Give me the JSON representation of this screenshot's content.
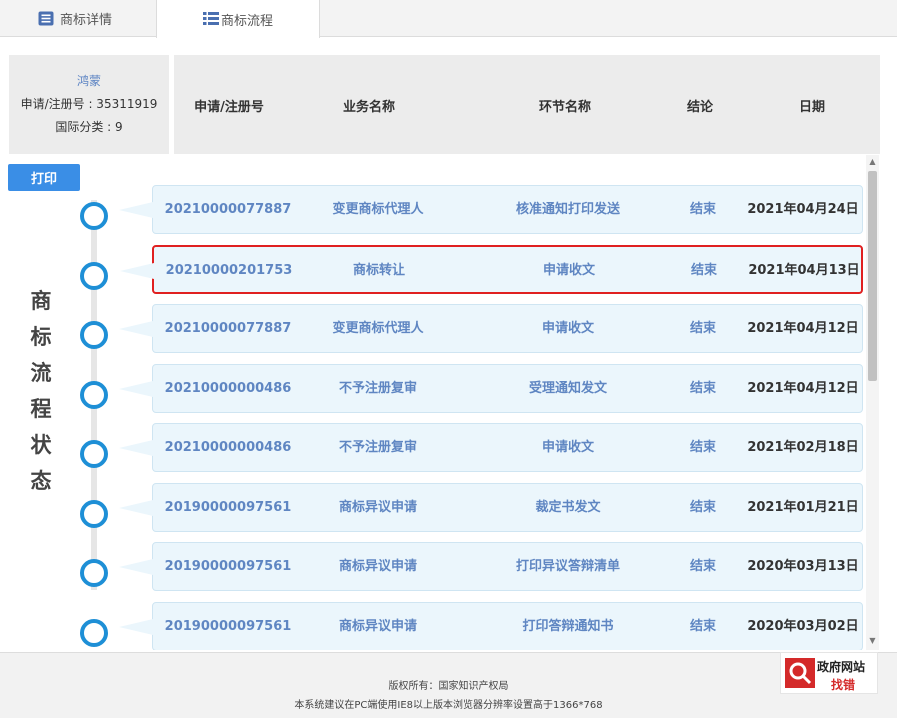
{
  "tabs": [
    {
      "label": "商标详情",
      "icon": "document-list-icon"
    },
    {
      "label": "商标流程",
      "icon": "grid-list-icon"
    }
  ],
  "info": {
    "name": "鸿蒙",
    "reg_line": "申请/注册号 : 35311919",
    "class_line": "国际分类 : 9"
  },
  "header": {
    "reg_no": "申请/注册号",
    "business": "业务名称",
    "step": "环节名称",
    "result": "结论",
    "date": "日期"
  },
  "print_label": "打印",
  "side_title": [
    "商",
    "标",
    "流",
    "程",
    "状",
    "态"
  ],
  "rows": [
    {
      "reg_no": "20210000077887",
      "business": "变更商标代理人",
      "step": "核准通知打印发送",
      "result": "结束",
      "date": "2021年04月24日"
    },
    {
      "reg_no": "20210000201753",
      "business": "商标转让",
      "step": "申请收文",
      "result": "结束",
      "date": "2021年04月13日",
      "highlighted": true
    },
    {
      "reg_no": "20210000077887",
      "business": "变更商标代理人",
      "step": "申请收文",
      "result": "结束",
      "date": "2021年04月12日"
    },
    {
      "reg_no": "20210000000486",
      "business": "不予注册复审",
      "step": "受理通知发文",
      "result": "结束",
      "date": "2021年04月12日"
    },
    {
      "reg_no": "20210000000486",
      "business": "不予注册复审",
      "step": "申请收文",
      "result": "结束",
      "date": "2021年02月18日"
    },
    {
      "reg_no": "20190000097561",
      "business": "商标异议申请",
      "step": "裁定书发文",
      "result": "结束",
      "date": "2021年01月21日"
    },
    {
      "reg_no": "20190000097561",
      "business": "商标异议申请",
      "step": "打印异议答辩清单",
      "result": "结束",
      "date": "2020年03月13日"
    },
    {
      "reg_no": "20190000097561",
      "business": "商标异议申请",
      "step": "打印答辩通知书",
      "result": "结束",
      "date": "2020年03月02日"
    }
  ],
  "footer": {
    "copyright": "版权所有：国家知识产权局",
    "note": "本系统建议在PC端使用IE8以上版本浏览器分辨率设置高于1366*768"
  },
  "gov_badge": {
    "line1": "政府网站",
    "line2": "找错"
  },
  "colors": {
    "accent": "#1e8fd6",
    "link": "#5f86c2",
    "highlight": "#e02020",
    "button": "#3a8ee6"
  }
}
